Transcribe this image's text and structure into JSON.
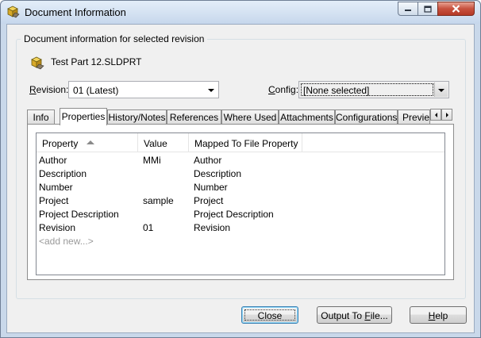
{
  "window": {
    "title": "Document Information"
  },
  "group": {
    "legend": "Document information for selected revision"
  },
  "document": {
    "name": "Test Part 12.SLDPRT"
  },
  "revision": {
    "label_prefix": "R",
    "label_rest": "evision:",
    "value": "01 (Latest)"
  },
  "config": {
    "label_prefix": "C",
    "label_rest": "onfig:",
    "value": "[None selected]"
  },
  "tabs": [
    {
      "label": "Info"
    },
    {
      "label": "Properties"
    },
    {
      "label": "History/Notes"
    },
    {
      "label": "References"
    },
    {
      "label": "Where Used"
    },
    {
      "label": "Attachments"
    },
    {
      "label": "Configurations"
    },
    {
      "label": "Preview"
    }
  ],
  "table": {
    "columns": [
      "Property",
      "Value",
      "Mapped To File Property"
    ],
    "rows": [
      [
        "Author",
        "MMi",
        "Author"
      ],
      [
        "Description",
        "",
        "Description"
      ],
      [
        "Number",
        "",
        "Number"
      ],
      [
        "Project",
        "sample",
        "Project"
      ],
      [
        "Project Description",
        "",
        "Project Description"
      ],
      [
        "Revision",
        "01",
        "Revision"
      ]
    ],
    "add_new": "<add new...>"
  },
  "buttons": {
    "close": "Close",
    "output_prefix": "Output To ",
    "output_underline": "F",
    "output_rest": "ile...",
    "help_underline": "H",
    "help_rest": "elp"
  },
  "icons": {
    "app": "solidworks-part-icon",
    "document": "solidworks-part-icon"
  }
}
